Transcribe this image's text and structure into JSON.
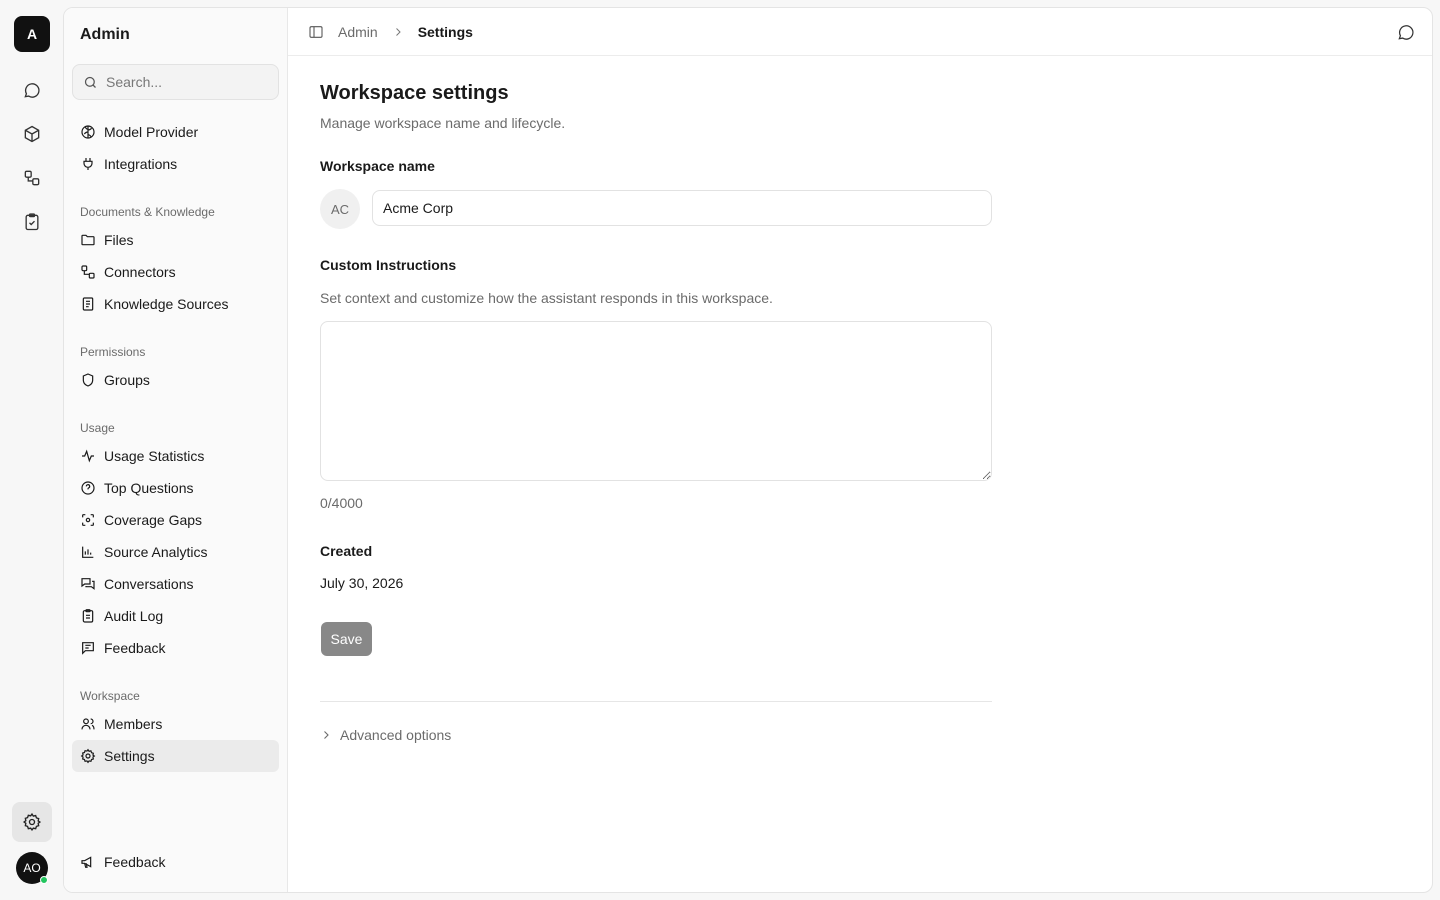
{
  "rail": {
    "logo_letter": "A",
    "user_initials": "AO"
  },
  "sidebar": {
    "title": "Admin",
    "search_placeholder": "Search...",
    "top_items": [
      {
        "label": "Model Provider",
        "icon": "brain-icon"
      },
      {
        "label": "Integrations",
        "icon": "plug-icon"
      }
    ],
    "sections": [
      {
        "label": "Documents & Knowledge",
        "items": [
          {
            "label": "Files",
            "icon": "folder-icon"
          },
          {
            "label": "Connectors",
            "icon": "connectors-icon"
          },
          {
            "label": "Knowledge Sources",
            "icon": "book-icon"
          }
        ]
      },
      {
        "label": "Permissions",
        "items": [
          {
            "label": "Groups",
            "icon": "shield-icon"
          }
        ]
      },
      {
        "label": "Usage",
        "items": [
          {
            "label": "Usage Statistics",
            "icon": "activity-icon"
          },
          {
            "label": "Top Questions",
            "icon": "question-icon"
          },
          {
            "label": "Coverage Gaps",
            "icon": "scan-icon"
          },
          {
            "label": "Source Analytics",
            "icon": "bar-chart-icon"
          },
          {
            "label": "Conversations",
            "icon": "chats-icon"
          },
          {
            "label": "Audit Log",
            "icon": "clipboard-icon"
          },
          {
            "label": "Feedback",
            "icon": "message-square-icon"
          }
        ]
      },
      {
        "label": "Workspace",
        "items": [
          {
            "label": "Members",
            "icon": "users-icon"
          },
          {
            "label": "Settings",
            "icon": "gear-icon",
            "active": true
          }
        ]
      }
    ],
    "footer_feedback": "Feedback"
  },
  "topbar": {
    "crumb_parent": "Admin",
    "crumb_current": "Settings"
  },
  "main": {
    "title": "Workspace settings",
    "subtitle": "Manage workspace name and lifecycle.",
    "name_label": "Workspace name",
    "workspace_initials": "AC",
    "workspace_name": "Acme Corp",
    "instructions_label": "Custom Instructions",
    "instructions_help": "Set context and customize how the assistant responds in this workspace.",
    "instructions_value": "",
    "char_count": "0/4000",
    "created_label": "Created",
    "created_value": "July 30, 2026",
    "save_label": "Save",
    "advanced_label": "Advanced options"
  },
  "colors": {
    "accent_dark": "#111111",
    "status_online": "#22c55e",
    "save_disabled": "#888888"
  }
}
